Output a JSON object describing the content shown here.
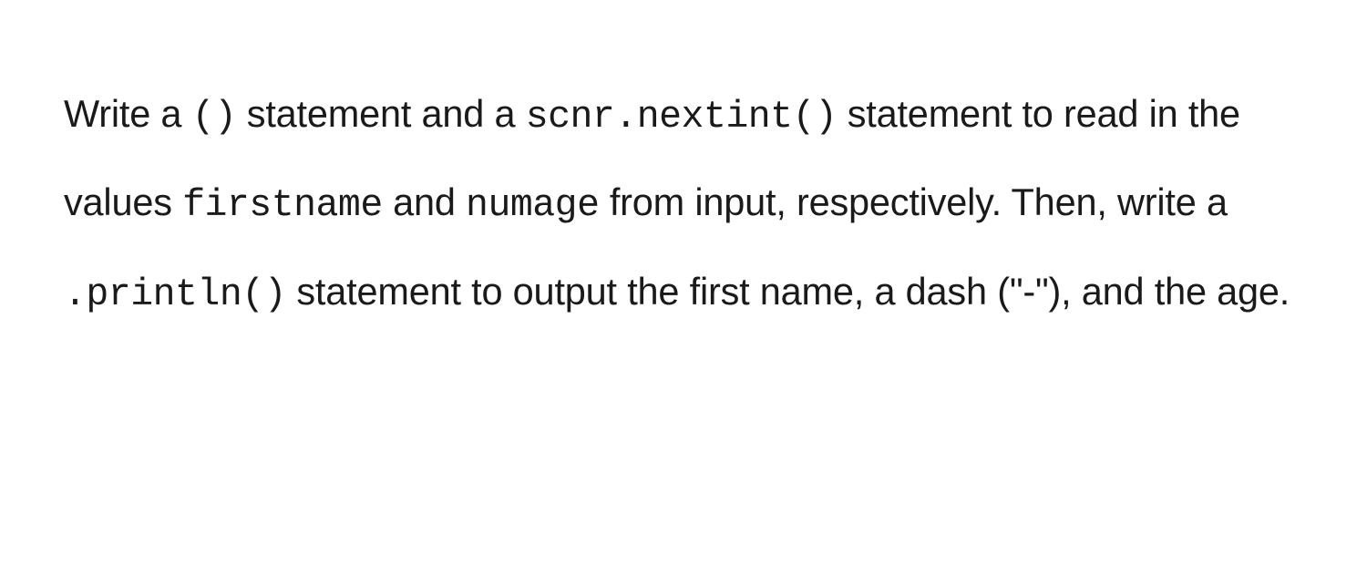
{
  "text": {
    "part1": "Write a ",
    "code1": "()",
    "part2": " statement and a ",
    "code2": "scnr.nextint()",
    "part3": " statement to read in the values ",
    "code3": "firstname",
    "part4": " and ",
    "code4": "numage",
    "part5": " from input, respectively. Then, write a ",
    "code5": ".println()",
    "part6": " statement to output the first name, a dash (\"-\"), and the age."
  }
}
